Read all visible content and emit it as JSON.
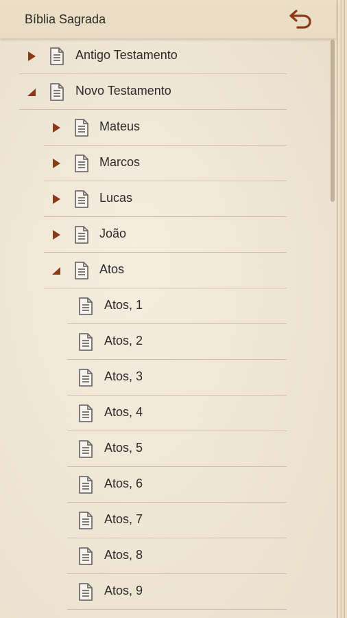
{
  "app": {
    "title": "Bíblia Sagrada",
    "back_icon": "undo-arrow-icon"
  },
  "colors": {
    "accent": "#8a3a16",
    "icon_gray": "#6f6f6f",
    "divider": "#cabfae"
  },
  "tree": [
    {
      "label": "Antigo Testamento",
      "level": 0,
      "state": "collapsed"
    },
    {
      "label": "Novo Testamento",
      "level": 0,
      "state": "expanded"
    },
    {
      "label": "Mateus",
      "level": 1,
      "state": "collapsed"
    },
    {
      "label": "Marcos",
      "level": 1,
      "state": "collapsed"
    },
    {
      "label": "Lucas",
      "level": 1,
      "state": "collapsed"
    },
    {
      "label": "João",
      "level": 1,
      "state": "collapsed"
    },
    {
      "label": "Atos",
      "level": 1,
      "state": "expanded"
    },
    {
      "label": "Atos, 1",
      "level": 2,
      "state": "leaf"
    },
    {
      "label": "Atos, 2",
      "level": 2,
      "state": "leaf"
    },
    {
      "label": "Atos, 3",
      "level": 2,
      "state": "leaf"
    },
    {
      "label": "Atos, 4",
      "level": 2,
      "state": "leaf"
    },
    {
      "label": "Atos, 5",
      "level": 2,
      "state": "leaf"
    },
    {
      "label": "Atos, 6",
      "level": 2,
      "state": "leaf"
    },
    {
      "label": "Atos, 7",
      "level": 2,
      "state": "leaf"
    },
    {
      "label": "Atos, 8",
      "level": 2,
      "state": "leaf"
    },
    {
      "label": "Atos, 9",
      "level": 2,
      "state": "leaf"
    }
  ]
}
